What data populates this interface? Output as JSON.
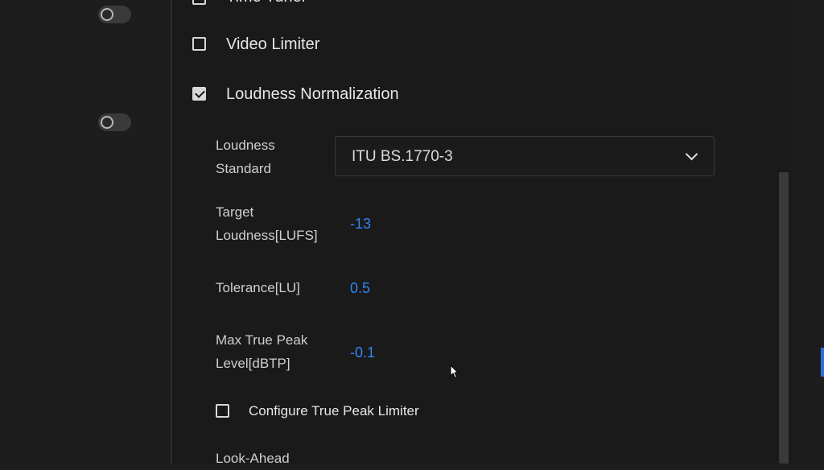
{
  "settings": {
    "partial_top_label": "Time Tuner",
    "video_limiter": {
      "label": "Video Limiter",
      "checked": false
    },
    "loudness_normalization": {
      "label": "Loudness Normalization",
      "checked": true
    },
    "loudness_standard": {
      "label": "Loudness Standard",
      "value": "ITU BS.1770-3"
    },
    "target_loudness": {
      "label": "Target Loudness[LUFS]",
      "value": "-13"
    },
    "tolerance": {
      "label": "Tolerance[LU]",
      "value": "0.5"
    },
    "max_true_peak": {
      "label": "Max True Peak Level[dBTP]",
      "value": "-0.1"
    },
    "configure_true_peak_limiter": {
      "label": "Configure True Peak Limiter",
      "checked": false
    },
    "look_ahead": {
      "label": "Look-Ahead"
    }
  },
  "icons": {
    "dropdown": "chevron-down-icon",
    "cursor": "mouse-pointer-icon"
  },
  "colors": {
    "value_blue": "#2f86f0",
    "background": "#1a1a1a"
  }
}
